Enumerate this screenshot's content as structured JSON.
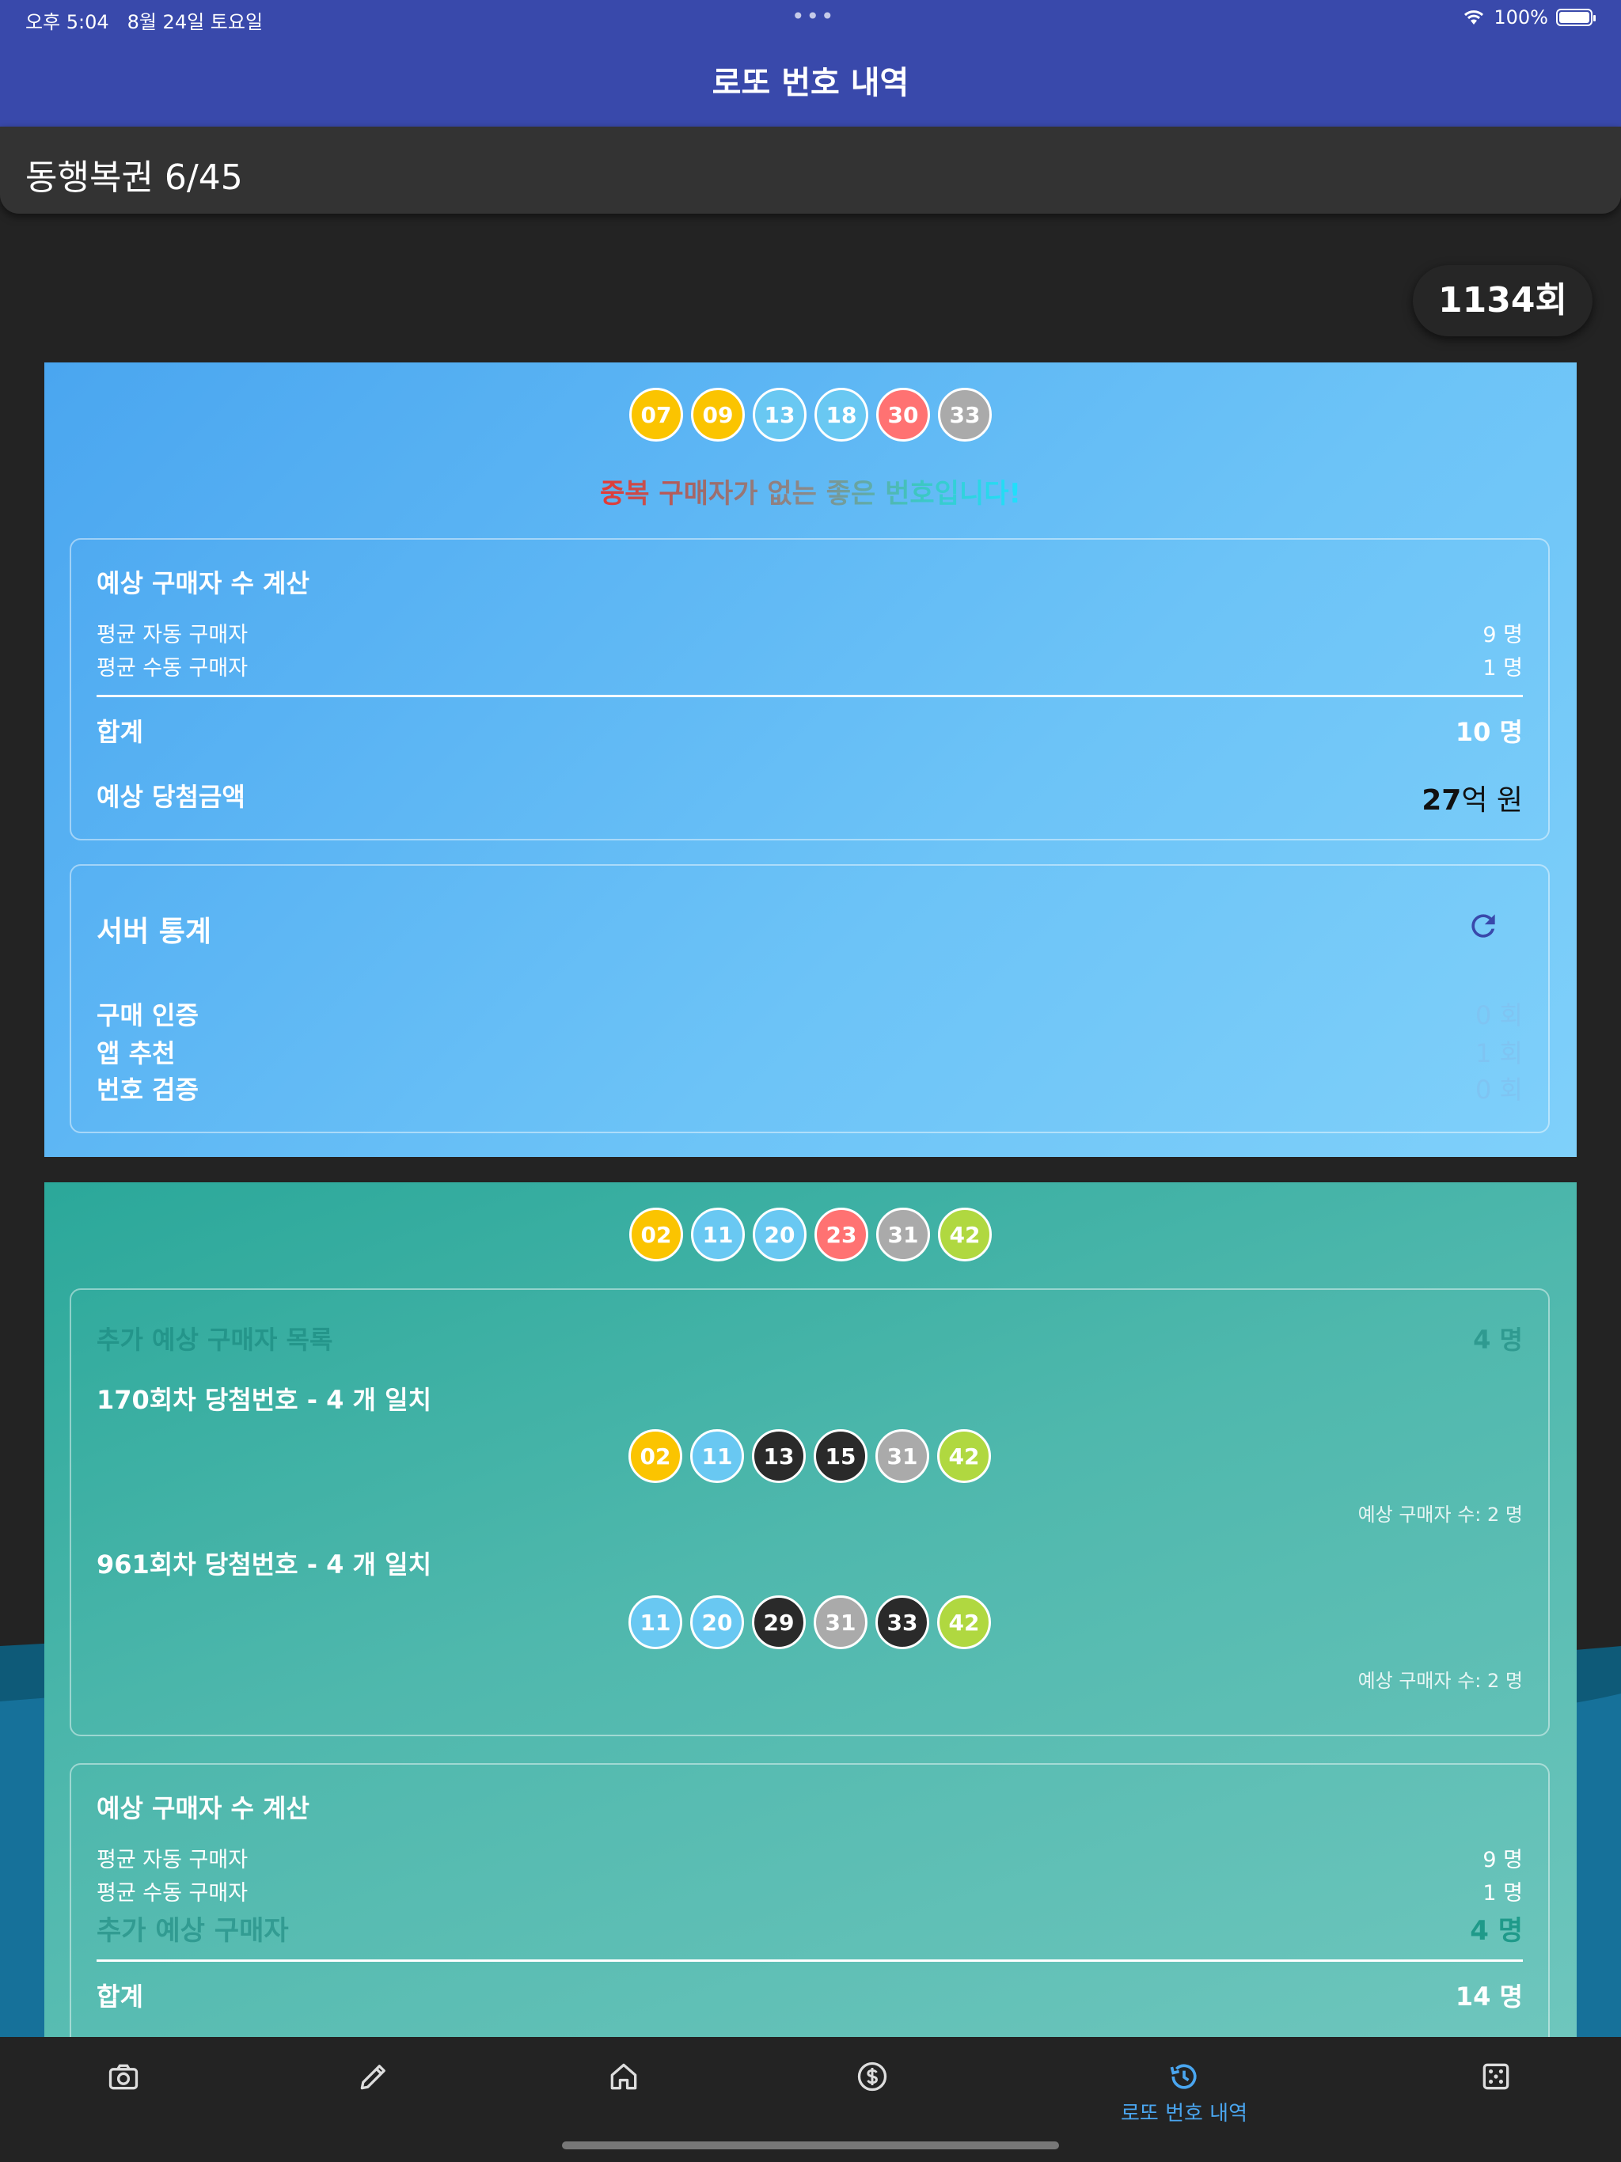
{
  "status_bar": {
    "time": "오후 5:04",
    "date": "8월 24일 토요일",
    "battery": "100%"
  },
  "app_bar": {
    "title": "로또 번호 내역"
  },
  "subheader": {
    "title": "동행복권 6/45"
  },
  "round": {
    "label": "1134회"
  },
  "card1": {
    "numbers": [
      "07",
      "09",
      "13",
      "18",
      "30",
      "33"
    ],
    "message": "중복 구매자가 없는 좋은 번호입니다!",
    "estimate": {
      "title": "예상 구매자 수 계산",
      "auto_label": "평균 자동 구매자",
      "auto_value": "9 명",
      "manual_label": "평균 수동 구매자",
      "manual_value": "1 명",
      "total_label": "합계",
      "total_value": "10 명",
      "prize_label": "예상 당첨금액",
      "prize_num": "27",
      "prize_unit": "억 원"
    },
    "server": {
      "title": "서버 통계",
      "purchase_label": "구매 인증",
      "purchase_value": "0 회",
      "recommend_label": "앱 추천",
      "recommend_value": "1 회",
      "verify_label": "번호 검증",
      "verify_value": "0 회"
    }
  },
  "card2": {
    "numbers": [
      "02",
      "11",
      "20",
      "23",
      "31",
      "42"
    ],
    "extra": {
      "title": "추가 예상 구매자 목록",
      "count": "4 명",
      "matches": [
        {
          "title": "170회차 당첨번호 - 4 개 일치",
          "numbers": [
            "02",
            "11",
            "13",
            "15",
            "31",
            "42"
          ],
          "note": "예상 구매자 수: 2 명"
        },
        {
          "title": "961회차 당첨번호 - 4 개 일치",
          "numbers": [
            "11",
            "20",
            "29",
            "31",
            "33",
            "42"
          ],
          "note": "예상 구매자 수: 2 명"
        }
      ]
    },
    "estimate": {
      "title": "예상 구매자 수 계산",
      "auto_label": "평균 자동 구매자",
      "auto_value": "9 명",
      "manual_label": "평균 수동 구매자",
      "manual_value": "1 명",
      "extra_label": "추가 예상 구매자",
      "extra_value": "4 명",
      "total_label": "합계",
      "total_value": "14 명"
    }
  },
  "nav": {
    "items": [
      {
        "icon": "camera-icon"
      },
      {
        "icon": "pencil-icon"
      },
      {
        "icon": "home-icon"
      },
      {
        "icon": "dollar-icon"
      },
      {
        "icon": "history-icon",
        "label": "로또 번호 내역",
        "active": true
      },
      {
        "icon": "dice-icon"
      }
    ]
  },
  "colors": {
    "primary": "#3949ab",
    "accent": "#4aa6f0",
    "ball_yellow": "#fbc400",
    "ball_blue": "#69c8f2",
    "ball_red": "#ff7272",
    "ball_gray": "#aaaaaa",
    "ball_green": "#b0d840",
    "ball_black": "#2a2a2a"
  }
}
